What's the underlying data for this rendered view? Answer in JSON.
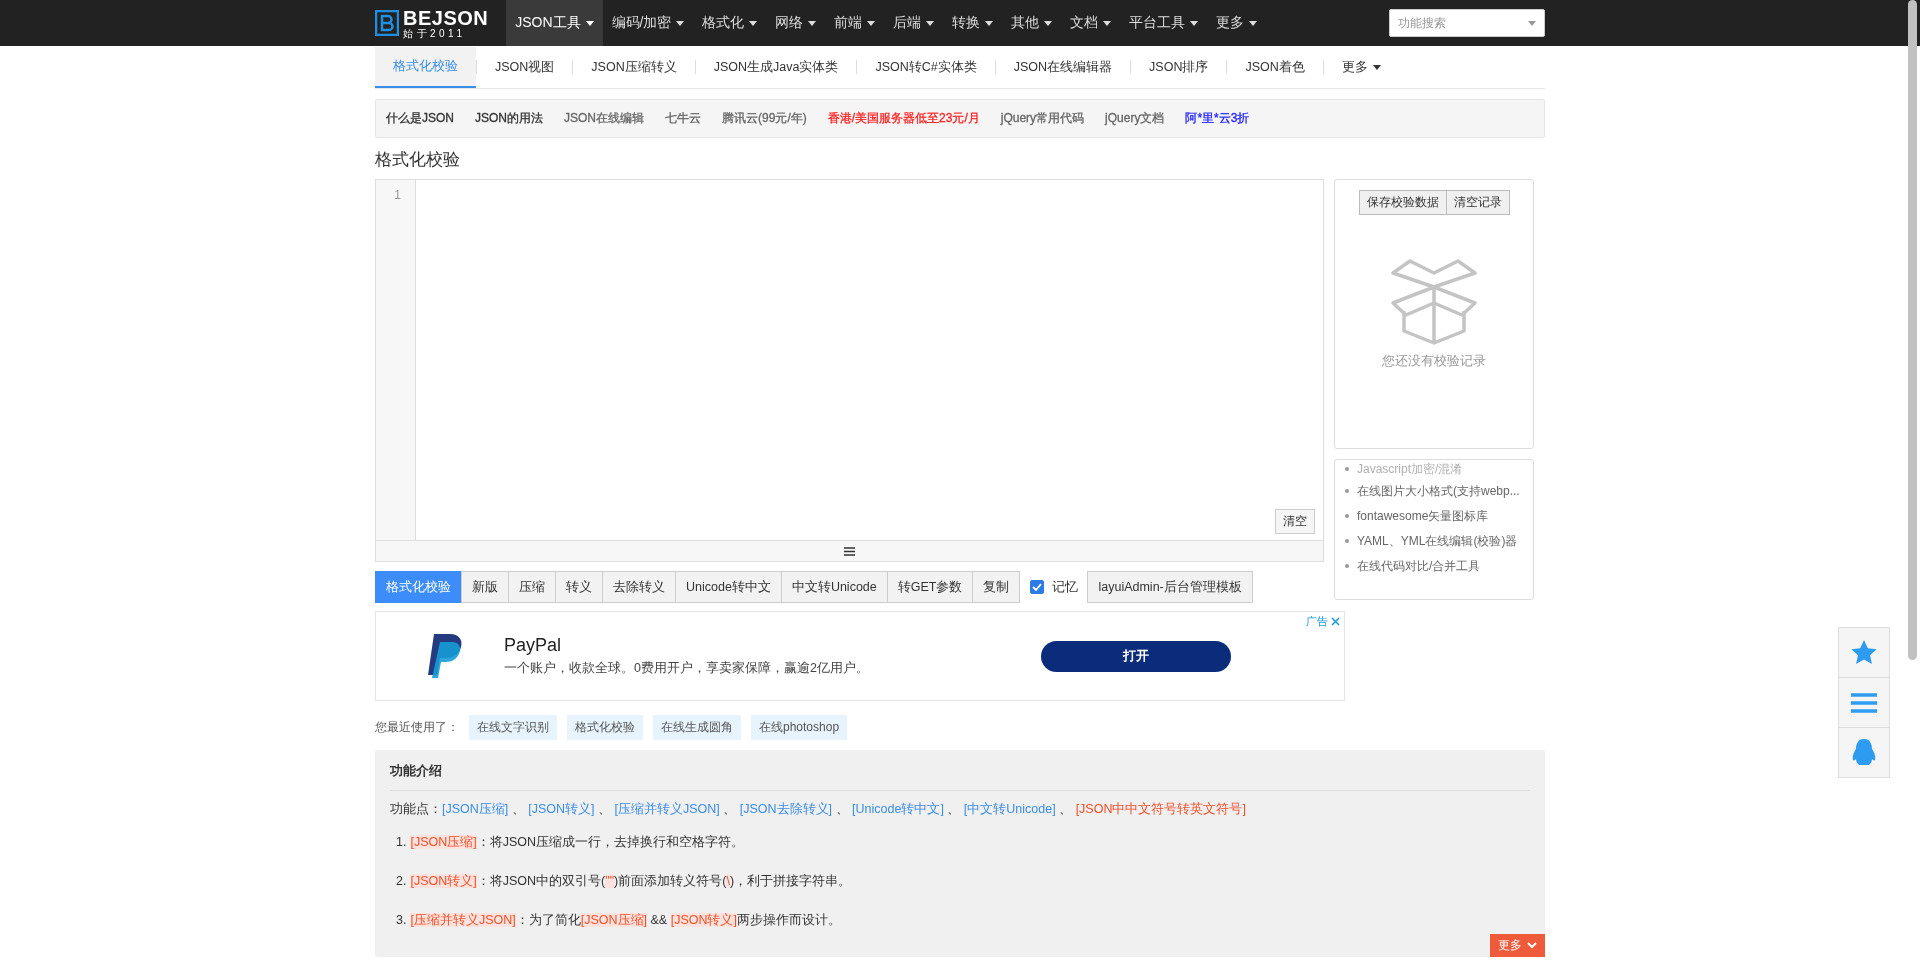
{
  "navbar": {
    "logo": {
      "title": "BEJSON",
      "subtitle": "始于2011"
    },
    "items": [
      {
        "label": "JSON工具",
        "selected": true
      },
      {
        "label": "编码/加密",
        "selected": false
      },
      {
        "label": "格式化",
        "selected": false
      },
      {
        "label": "网络",
        "selected": false
      },
      {
        "label": "前端",
        "selected": false
      },
      {
        "label": "后端",
        "selected": false
      },
      {
        "label": "转换",
        "selected": false
      },
      {
        "label": "其他",
        "selected": false
      },
      {
        "label": "文档",
        "selected": false
      },
      {
        "label": "平台工具",
        "selected": false
      },
      {
        "label": "更多",
        "selected": false
      }
    ],
    "search": {
      "placeholder": "功能搜索"
    }
  },
  "subtabs": [
    {
      "label": "格式化校验",
      "selected": true,
      "kind": "tab"
    },
    {
      "label": "JSON视图",
      "selected": false,
      "kind": "tab"
    },
    {
      "label": "JSON压缩转义",
      "selected": false,
      "kind": "tab"
    },
    {
      "label": "JSON生成Java实体类",
      "selected": false,
      "kind": "tab"
    },
    {
      "label": "JSON转C#实体类",
      "selected": false,
      "kind": "tab"
    },
    {
      "label": "JSON在线编辑器",
      "selected": false,
      "kind": "tab"
    },
    {
      "label": "JSON排序",
      "selected": false,
      "kind": "tab"
    },
    {
      "label": "JSON着色",
      "selected": false,
      "kind": "tab"
    },
    {
      "label": "更多",
      "selected": false,
      "kind": "dropdown"
    }
  ],
  "quick_links": [
    {
      "label": "什么是JSON",
      "color": "#333333"
    },
    {
      "label": "JSON的用法",
      "color": "#333333"
    },
    {
      "label": "JSON在线编辑",
      "color": "#666666"
    },
    {
      "label": "七牛云",
      "color": "#666666"
    },
    {
      "label": "腾讯云(99元/年)",
      "color": "#666666"
    },
    {
      "label": "香港/美国服务器低至23元/月",
      "color": "#ff2222"
    },
    {
      "label": "jQuery常用代码",
      "color": "#666666"
    },
    {
      "label": "jQuery文档",
      "color": "#666666"
    },
    {
      "label": "阿*里*云3折",
      "color": "#2222ff"
    }
  ],
  "page_title": "格式化校验",
  "editor": {
    "line_numbers": [
      "1"
    ],
    "clear_button": "清空"
  },
  "history": {
    "buttons": [
      "保存校验数据",
      "清空记录"
    ],
    "empty_text": "您还没有校验记录"
  },
  "related_tools": [
    {
      "label": "Javascript加密/混淆",
      "faded": true
    },
    {
      "label": "在线图片大小格式(支持webp...",
      "faded": false
    },
    {
      "label": "fontawesome矢量图标库",
      "faded": false
    },
    {
      "label": "YAML、YML在线编辑(校验)器",
      "faded": false
    },
    {
      "label": "在线代码对比/合并工具",
      "faded": false
    }
  ],
  "toolbar": {
    "buttons": [
      {
        "label": "格式化校验",
        "selected": true
      },
      {
        "label": "新版",
        "selected": false
      },
      {
        "label": "压缩",
        "selected": false
      },
      {
        "label": "转义",
        "selected": false
      },
      {
        "label": "去除转义",
        "selected": false
      },
      {
        "label": "Unicode转中文",
        "selected": false
      },
      {
        "label": "中文转Unicode",
        "selected": false
      },
      {
        "label": "转GET参数",
        "selected": false
      },
      {
        "label": "复制",
        "selected": false
      }
    ],
    "memory": {
      "label": "记忆",
      "checked": true
    },
    "extra_button": "layuiAdmin-后台管理模板"
  },
  "ad": {
    "badge": "广告",
    "title": "PayPal",
    "description": "一个账户，收款全球。0费用开户，享卖家保障，赢逾2亿用户。",
    "button": "打开"
  },
  "recent": {
    "label": "您最近使用了：",
    "items": [
      "在线文字识别",
      "格式化校验",
      "在线生成圆角",
      "在线photoshop"
    ]
  },
  "intro": {
    "title": "功能介绍",
    "points_label": "功能点：",
    "points": [
      {
        "kind": "link",
        "text": "[JSON压缩]",
        "color": "#3a8ee6"
      },
      {
        "kind": "sep",
        "text": "、"
      },
      {
        "kind": "link",
        "text": "[JSON转义]",
        "color": "#3a8ee6"
      },
      {
        "kind": "sep",
        "text": "、"
      },
      {
        "kind": "link",
        "text": "[压缩并转义JSON]",
        "color": "#3a8ee6"
      },
      {
        "kind": "sep",
        "text": "、"
      },
      {
        "kind": "link",
        "text": "[JSON去除转义]",
        "color": "#3a8ee6"
      },
      {
        "kind": "sep",
        "text": "、"
      },
      {
        "kind": "link",
        "text": "[Unicode转中文]",
        "color": "#3a8ee6"
      },
      {
        "kind": "sep",
        "text": "、"
      },
      {
        "kind": "link",
        "text": "[中文转Unicode]",
        "color": "#3a8ee6"
      },
      {
        "kind": "sep",
        "text": "、"
      },
      {
        "kind": "link",
        "text": "[JSON中中文符号转英文符号]",
        "color": "#f0502a"
      }
    ],
    "steps": [
      {
        "number": "1.",
        "segments": [
          {
            "kind": "code",
            "text": "[JSON压缩]"
          },
          {
            "kind": "text",
            "text": "：将JSON压缩成一行，去掉换行和空格字符。"
          }
        ]
      },
      {
        "number": "2.",
        "segments": [
          {
            "kind": "code",
            "text": "[JSON转义]"
          },
          {
            "kind": "text",
            "text": "：将JSON中的双引号("
          },
          {
            "kind": "code",
            "text": "\"\""
          },
          {
            "kind": "text",
            "text": ")前面添加转义符号("
          },
          {
            "kind": "code",
            "text": "\\"
          },
          {
            "kind": "text",
            "text": ")，利于拼接字符串。"
          }
        ]
      },
      {
        "number": "3.",
        "segments": [
          {
            "kind": "code",
            "text": "[压缩并转义JSON]"
          },
          {
            "kind": "text",
            "text": "：为了简化"
          },
          {
            "kind": "code",
            "text": "[JSON压缩]"
          },
          {
            "kind": "text",
            "text": " && "
          },
          {
            "kind": "code",
            "text": "[JSON转义]"
          },
          {
            "kind": "text",
            "text": "两步操作而设计。"
          }
        ]
      }
    ],
    "more_button": "更多"
  }
}
